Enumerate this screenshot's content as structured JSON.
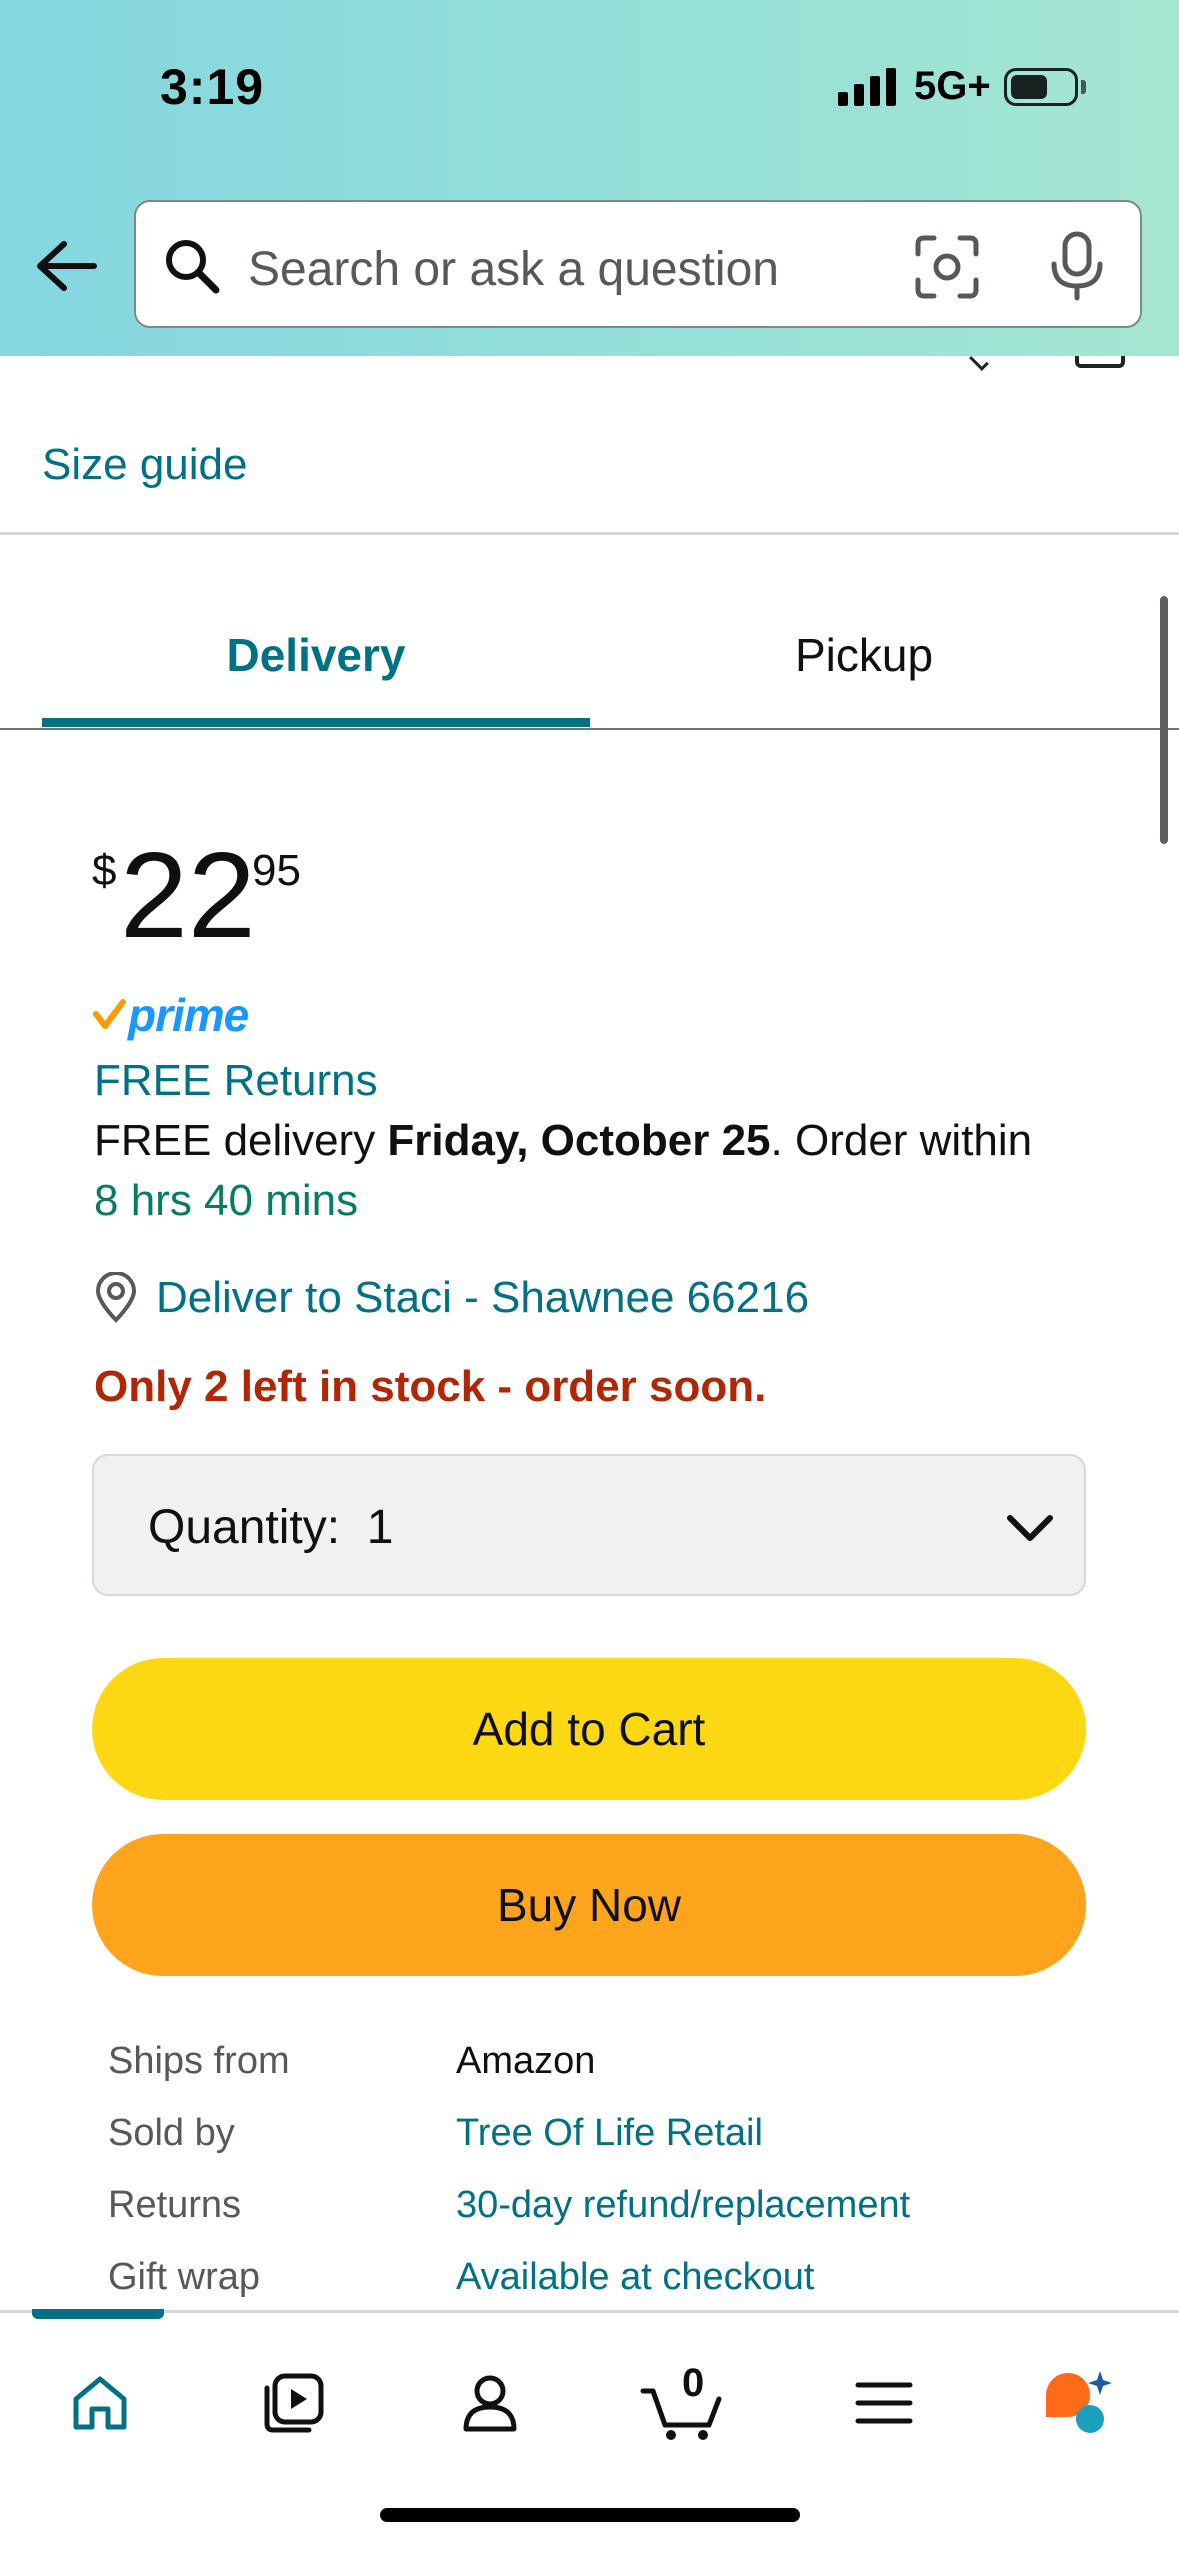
{
  "status_bar": {
    "time": "3:19",
    "network": "5G+"
  },
  "search": {
    "placeholder": "Search or ask a question"
  },
  "size_guide": "Size guide",
  "tabs": [
    {
      "label": "Delivery",
      "selected": true
    },
    {
      "label": "Pickup",
      "selected": false
    }
  ],
  "price": {
    "symbol": "$",
    "whole": "22",
    "fraction": "95"
  },
  "prime_label": "prime",
  "free_returns": "FREE Returns",
  "delivery": {
    "prefix": "FREE delivery ",
    "date": "Friday, October 25",
    "suffix": ". Order within",
    "countdown": "8 hrs 40 mins"
  },
  "deliver_to": "Deliver to Staci - Shawnee 66216",
  "stock_warning": "Only 2 left in stock - order soon.",
  "quantity": {
    "label": "Quantity:",
    "value": "1"
  },
  "buttons": {
    "add_to_cart": "Add to Cart",
    "buy_now": "Buy Now"
  },
  "info_rows": [
    {
      "key": "Ships from",
      "value": "Amazon",
      "link": false
    },
    {
      "key": "Sold by",
      "value": "Tree Of Life Retail",
      "link": true
    },
    {
      "key": "Returns",
      "value": "30-day refund/replacement",
      "link": true
    },
    {
      "key": "Gift wrap",
      "value": "Available at checkout",
      "link": true
    }
  ],
  "cart_count": "0",
  "nav_icons": [
    "home-icon",
    "video-icon",
    "account-icon",
    "cart-icon",
    "menu-icon",
    "rufus-ai-icon"
  ],
  "colors": {
    "link": "#007185",
    "add_to_cart": "#FFD814",
    "buy_now": "#FFA41C",
    "stock_warning": "#B12704",
    "countdown": "#067D62",
    "prime_blue": "#1A98FF",
    "prime_check": "#FF9900"
  }
}
